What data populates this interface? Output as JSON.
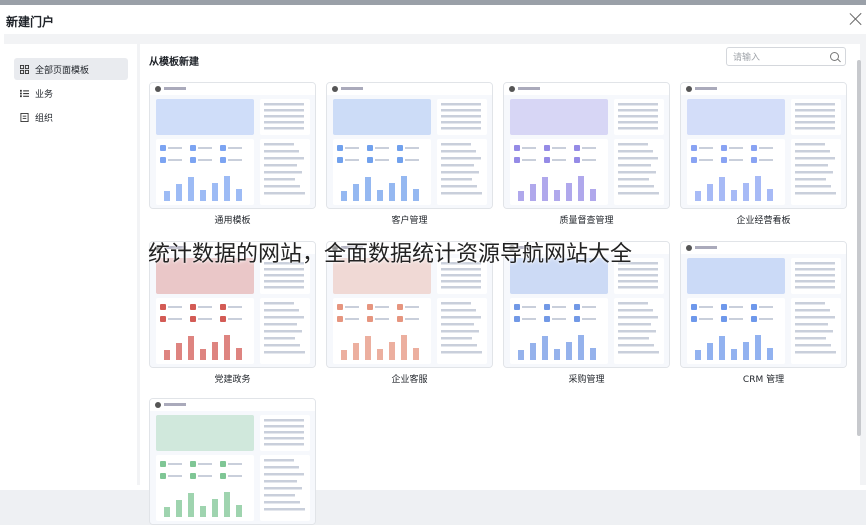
{
  "dialog": {
    "title": "新建门户",
    "section_title": "从模板新建"
  },
  "search": {
    "placeholder": "请输入"
  },
  "sidebar": {
    "items": [
      {
        "label": "全部页面模板",
        "icon": "grid-icon",
        "active": true
      },
      {
        "label": "业务",
        "icon": "list-icon",
        "active": false
      },
      {
        "label": "组织",
        "icon": "doc-icon",
        "active": false
      }
    ]
  },
  "templates": [
    {
      "label": "通用模板",
      "theme": "#5b8def"
    },
    {
      "label": "客户管理",
      "theme": "#4e89e8"
    },
    {
      "label": "质量督查管理",
      "theme": "#7b6ee0"
    },
    {
      "label": "企业经营看板",
      "theme": "#6c8cf0"
    },
    {
      "label": "党建政务",
      "theme": "#c8322b"
    },
    {
      "label": "企业客服",
      "theme": "#e07a5f"
    },
    {
      "label": "采购管理",
      "theme": "#4f7fe0"
    },
    {
      "label": "CRM 管理",
      "theme": "#4a7ee6"
    },
    {
      "label": "",
      "theme": "#5fb87a"
    }
  ],
  "watermark": "统计数据的网站，全面数据统计资源导航网站大全"
}
